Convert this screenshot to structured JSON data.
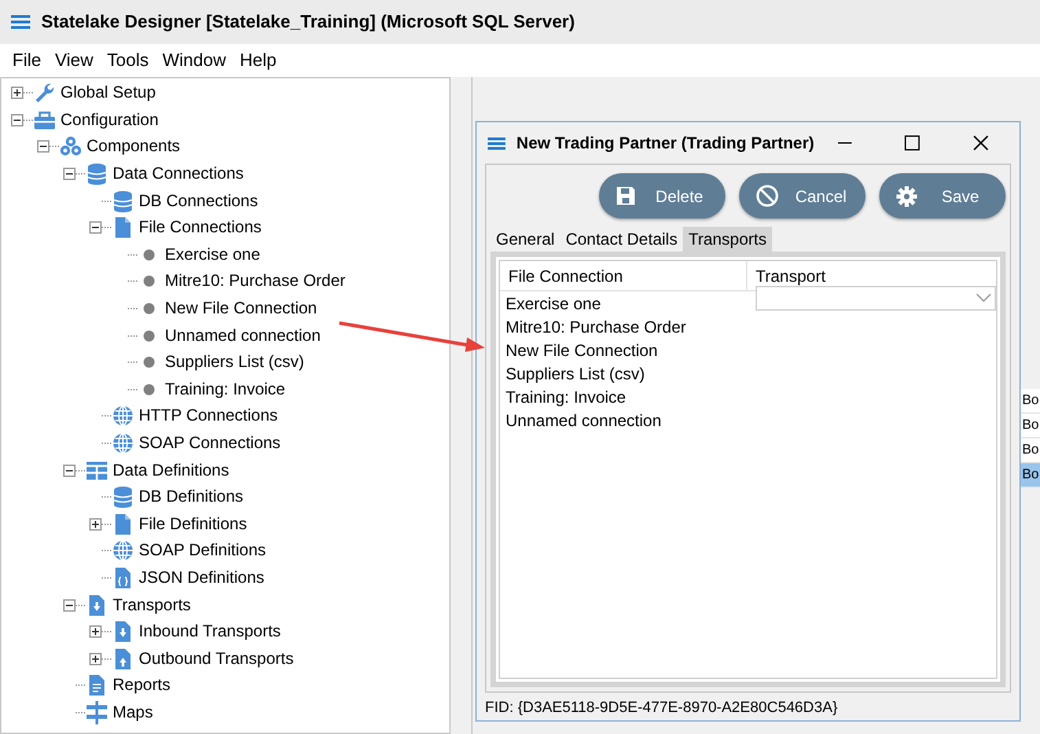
{
  "window": {
    "title": "Statelake Designer [Statelake_Training] (Microsoft SQL Server)"
  },
  "menu": [
    "File",
    "View",
    "Tools",
    "Window",
    "Help"
  ],
  "tree": [
    {
      "label": "Global Setup",
      "kind": "wrench",
      "expanded": false
    },
    {
      "label": "Configuration",
      "kind": "toolbox",
      "expanded": true,
      "children": [
        {
          "label": "Components",
          "kind": "cubes",
          "expanded": true,
          "children": [
            {
              "label": "Data Connections",
              "kind": "database",
              "expanded": true,
              "children": [
                {
                  "label": "DB Connections",
                  "kind": "database"
                },
                {
                  "label": "File Connections",
                  "kind": "file",
                  "expanded": true,
                  "children": [
                    {
                      "label": "Exercise one",
                      "kind": "dot"
                    },
                    {
                      "label": "Mitre10: Purchase Order",
                      "kind": "dot"
                    },
                    {
                      "label": "New File Connection",
                      "kind": "dot"
                    },
                    {
                      "label": "Unnamed connection",
                      "kind": "dot"
                    },
                    {
                      "label": "Suppliers List (csv)",
                      "kind": "dot"
                    },
                    {
                      "label": "Training: Invoice",
                      "kind": "dot"
                    }
                  ]
                },
                {
                  "label": "HTTP Connections",
                  "kind": "globe"
                },
                {
                  "label": "SOAP Connections",
                  "kind": "globe"
                }
              ]
            },
            {
              "label": "Data Definitions",
              "kind": "grid",
              "expanded": true,
              "children": [
                {
                  "label": "DB Definitions",
                  "kind": "database"
                },
                {
                  "label": "File Definitions",
                  "kind": "file",
                  "expanded": false
                },
                {
                  "label": "SOAP Definitions",
                  "kind": "globe"
                },
                {
                  "label": "JSON Definitions",
                  "kind": "json"
                }
              ]
            },
            {
              "label": "Transports",
              "kind": "download",
              "expanded": true,
              "children": [
                {
                  "label": "Inbound Transports",
                  "kind": "download",
                  "expanded": false
                },
                {
                  "label": "Outbound Transports",
                  "kind": "upload",
                  "expanded": false
                }
              ]
            },
            {
              "label": "Reports",
              "kind": "report"
            },
            {
              "label": "Maps",
              "kind": "maps"
            }
          ]
        }
      ]
    }
  ],
  "background_table": [
    {
      "text": "Bo",
      "selected": false
    },
    {
      "text": "Bo",
      "selected": false
    },
    {
      "text": "Bo",
      "selected": false
    },
    {
      "text": "Bo",
      "selected": true
    }
  ],
  "dialog": {
    "title": "New Trading Partner (Trading Partner)",
    "buttons": [
      {
        "label": "Delete",
        "kind": "save"
      },
      {
        "label": "Cancel",
        "kind": "cancel"
      },
      {
        "label": "Save",
        "kind": "gear"
      }
    ],
    "tabs": [
      {
        "label": "General",
        "selected": false
      },
      {
        "label": "Contact Details",
        "selected": false
      },
      {
        "label": "Transports",
        "selected": true
      }
    ],
    "columns": [
      "File Connection",
      "Transport"
    ],
    "rows": [
      {
        "file_connection": "Exercise one",
        "editor_open": true
      },
      {
        "file_connection": "Mitre10: Purchase Order",
        "editor_open": false
      },
      {
        "file_connection": "New File Connection",
        "editor_open": false
      },
      {
        "file_connection": "Suppliers List (csv)",
        "editor_open": false
      },
      {
        "file_connection": "Training: Invoice",
        "editor_open": false
      },
      {
        "file_connection": "Unnamed connection",
        "editor_open": false
      }
    ],
    "fid": "FID: {D3AE5118-9D5E-477E-8970-A2E80C546D3A}"
  }
}
